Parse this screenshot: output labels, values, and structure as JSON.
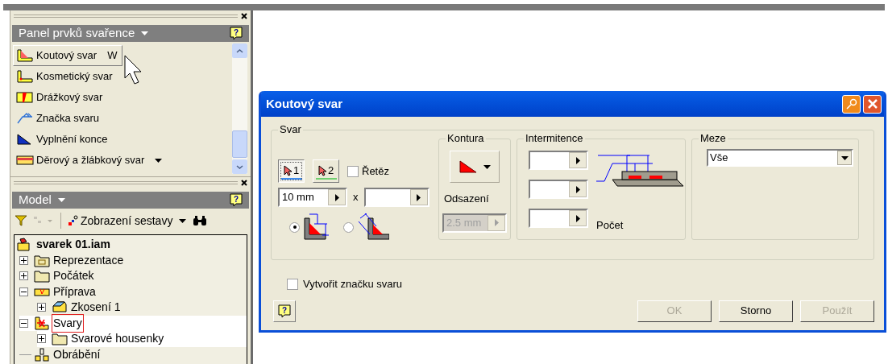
{
  "weld_panel": {
    "title": "Panel prvků svařence",
    "help": "?",
    "items": [
      {
        "kind": "fillet",
        "label": "Koutový svar",
        "shortcut": "W",
        "selected": true,
        "has_menu": false
      },
      {
        "kind": "cosmetic",
        "label": "Kosmetický svar",
        "selected": false,
        "has_menu": false
      },
      {
        "kind": "groove",
        "label": "Drážkový svar",
        "selected": false,
        "has_menu": false
      },
      {
        "kind": "symbol",
        "label": "Značka svaru",
        "selected": false,
        "has_menu": false
      },
      {
        "kind": "endfill",
        "label": "Vyplnění konce",
        "selected": false,
        "has_menu": false
      },
      {
        "kind": "bead",
        "label": "Děrový a žlábkový svar",
        "selected": false,
        "has_menu": true
      }
    ]
  },
  "model_panel": {
    "title": "Model",
    "help": "?",
    "view_button": "Zobrazení sestavy",
    "tree": {
      "kind": "assembly",
      "label": "svarek 01.iam",
      "selected": false,
      "children": [
        {
          "kind": "representations",
          "label": "Reprezentace",
          "expanded": false,
          "selected": false
        },
        {
          "kind": "folder",
          "label": "Počátek",
          "expanded": false,
          "selected": false
        },
        {
          "kind": "preparation",
          "label": "Příprava",
          "expanded": true,
          "selected": false,
          "children": [
            {
              "kind": "chamfer",
              "label": "Zkosení 1",
              "expanded": false,
              "selected": false
            }
          ]
        },
        {
          "kind": "welds",
          "label": "Svary",
          "expanded": true,
          "selected": true,
          "children": [
            {
              "kind": "folder",
              "label": "Svarové housenky",
              "expanded": false,
              "selected": false
            }
          ]
        },
        {
          "kind": "machining",
          "label": "Obrábění",
          "selected": false
        }
      ]
    }
  },
  "dialog": {
    "title": "Koutový svar",
    "help": "?",
    "group": "Svar",
    "selectors": [
      {
        "label": "1",
        "selected": true
      },
      {
        "label": "2",
        "selected": false
      }
    ],
    "chain": {
      "label": "Řetěz",
      "checked": false
    },
    "size": {
      "value": "10 mm",
      "disabled": false
    },
    "times": "x",
    "second_size": {
      "disabled": false
    },
    "placements": [
      {
        "selected": true
      },
      {
        "selected": false
      }
    ],
    "contour": {
      "title": "Kontura",
      "offset_label": "Odsazení",
      "offset": {
        "value": "2.5 mm",
        "disabled": true
      }
    },
    "intermittence": {
      "title": "Intermitence",
      "fields": [
        {
          "disabled": false
        },
        {
          "disabled": false
        },
        {
          "disabled": false
        }
      ],
      "count_label": "Počet"
    },
    "limits": {
      "title": "Meze",
      "value": "Vše"
    },
    "create_symbol": {
      "label": "Vytvořit značku svaru",
      "checked": false
    },
    "buttons": [
      {
        "label": "OK",
        "disabled": true
      },
      {
        "label": "Storno",
        "disabled": false
      },
      {
        "label": "Použít",
        "disabled": true
      }
    ]
  }
}
